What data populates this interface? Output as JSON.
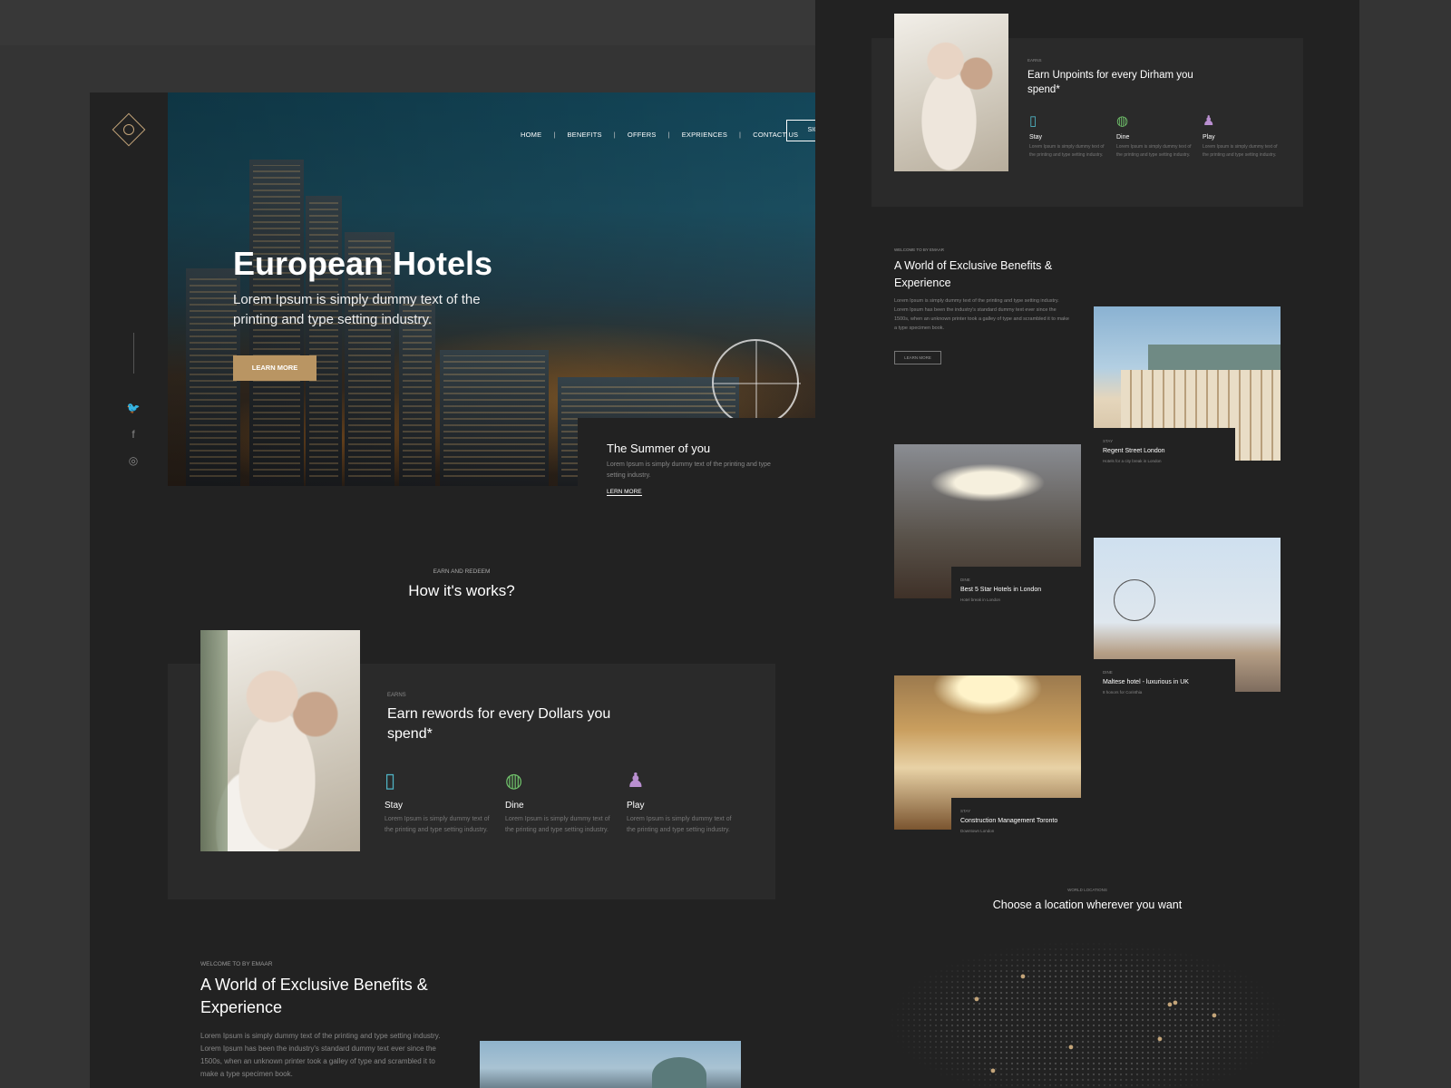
{
  "left": {
    "nav": [
      "HOME",
      "BENEFITS",
      "OFFERS",
      "EXPRIENCES",
      "CONTACT US"
    ],
    "signup_label": "SIGNUP",
    "hero": {
      "title": "European Hotels",
      "subtitle": "Lorem Ipsum is simply dummy text of the printing and type setting industry.",
      "cta": "LEARN MORE"
    },
    "summer": {
      "title": "The Summer of you",
      "text": "Lorem Ipsum is simply dummy text of the printing and type setting industry.",
      "link": "LERN MORE"
    },
    "how": {
      "small": "EARN AND REDEEM",
      "title": "How it's works?"
    },
    "earn": {
      "small": "EARNS",
      "title": "Earn rewords for every Dollars you spend*",
      "features": [
        {
          "icon": "phone-hotel-icon",
          "glyph": "▯",
          "label": "Stay",
          "text": "Lorem Ipsum is simply dummy text of the printing and type setting industry.",
          "color": "#4fb3c4"
        },
        {
          "icon": "dine-icon",
          "glyph": "◍",
          "label": "Dine",
          "text": "Lorem Ipsum is simply dummy text of the printing and type setting industry.",
          "color": "#6fbf6a"
        },
        {
          "icon": "play-icon",
          "glyph": "♟",
          "label": "Play",
          "text": "Lorem Ipsum is simply dummy text of the printing and type setting industry.",
          "color": "#b98fd0"
        }
      ]
    },
    "world": {
      "small": "WELCOME TO BY EMAAR",
      "title": "A World of Exclusive Benefits & Experience",
      "text": "Lorem Ipsum is simply dummy text of the printing and type setting industry. Lorem Ipsum has been the industry's standard dummy text ever since the 1500s, when an unknown printer took a galley of type and scrambled it to make a type specimen book."
    },
    "social": [
      {
        "icon": "twitter-icon",
        "glyph": "🐦"
      },
      {
        "icon": "facebook-icon",
        "glyph": "f"
      },
      {
        "icon": "instagram-icon",
        "glyph": "◎"
      }
    ]
  },
  "right": {
    "earn": {
      "small": "EARNS",
      "title": "Earn Unpoints for every Dirham you spend*",
      "features": [
        {
          "icon": "phone-hotel-icon",
          "glyph": "▯",
          "label": "Stay",
          "text": "Lorem Ipsum is simply dummy text of the printing and type setting industry.",
          "color": "#4fb3c4"
        },
        {
          "icon": "dine-icon",
          "glyph": "◍",
          "label": "Dine",
          "text": "Lorem Ipsum is simply dummy text of the printing and type setting industry.",
          "color": "#6fbf6a"
        },
        {
          "icon": "play-icon",
          "glyph": "♟",
          "label": "Play",
          "text": "Lorem Ipsum is simply dummy text of the printing and type setting industry.",
          "color": "#b98fd0"
        }
      ]
    },
    "world": {
      "small": "WELCOME TO BY EMAAR",
      "title": "A World of Exclusive Benefits & Experience",
      "text": "Lorem Ipsum is simply dummy text of the printing and type setting industry. Lorem Ipsum has been the industry's standard dummy text ever since the 1500s, when an unknown printer took a galley of type and scrambled it to make a type specimen book.",
      "cta": "LEARN MORE"
    },
    "hotels": [
      {
        "category": "STAY",
        "title": "Regent Street London",
        "sub": "Hotels for a city break in London"
      },
      {
        "category": "DINE",
        "title": "Best 5 Star Hotels in London",
        "sub": "Hotel break in London"
      },
      {
        "category": "DINE",
        "title": "Maltese hotel - luxurious in UK",
        "sub": "8 honors for Corinthia"
      },
      {
        "category": "STAY",
        "title": "Construction Management Toronto",
        "sub": "Downtown London"
      }
    ],
    "locations": {
      "small": "WORLD LOCATIONS",
      "title": "Choose a location wherever you want"
    },
    "accent_color": "#c4a57a"
  }
}
